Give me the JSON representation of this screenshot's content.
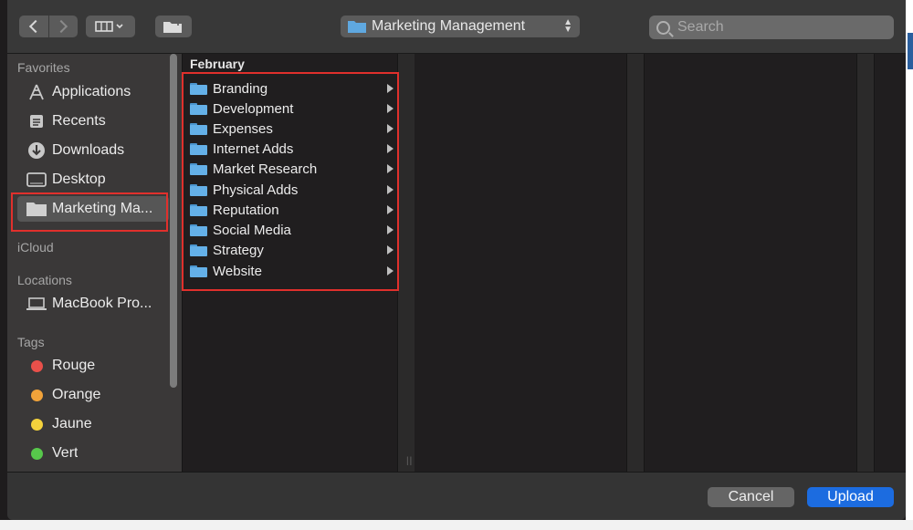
{
  "toolbar": {
    "path_title": "Marketing Management",
    "search_placeholder": "Search",
    "icons": [
      "chevron-left-icon",
      "chevron-right-icon",
      "column-view-icon",
      "new-folder-icon",
      "search-icon"
    ]
  },
  "sidebar": {
    "favorites_header": "Favorites",
    "favorites": [
      {
        "label": "Applications",
        "icon": "applications-icon"
      },
      {
        "label": "Recents",
        "icon": "recents-icon"
      },
      {
        "label": "Downloads",
        "icon": "downloads-icon"
      },
      {
        "label": "Desktop",
        "icon": "desktop-icon"
      },
      {
        "label": "Marketing Ma...",
        "icon": "folder-icon",
        "selected": true
      }
    ],
    "icloud_header": "iCloud",
    "locations_header": "Locations",
    "locations": [
      {
        "label": "MacBook Pro...",
        "icon": "laptop-icon"
      }
    ],
    "tags_header": "Tags",
    "tags": [
      {
        "label": "Rouge",
        "color": "#e9504a"
      },
      {
        "label": "Orange",
        "color": "#f2a33a"
      },
      {
        "label": "Jaune",
        "color": "#f4d23c"
      },
      {
        "label": "Vert",
        "color": "#57c84b"
      }
    ]
  },
  "column1": {
    "title": "February",
    "folders": [
      "Branding",
      "Development",
      "Expenses",
      "Internet Adds",
      "Market Research",
      "Physical Adds",
      "Reputation",
      "Social Media",
      "Strategy",
      "Website"
    ]
  },
  "footer": {
    "cancel_label": "Cancel",
    "upload_label": "Upload"
  },
  "colors": {
    "accent": "#1c6ce0",
    "highlight_box": "#e0302c",
    "folder": "#64b0e8"
  }
}
